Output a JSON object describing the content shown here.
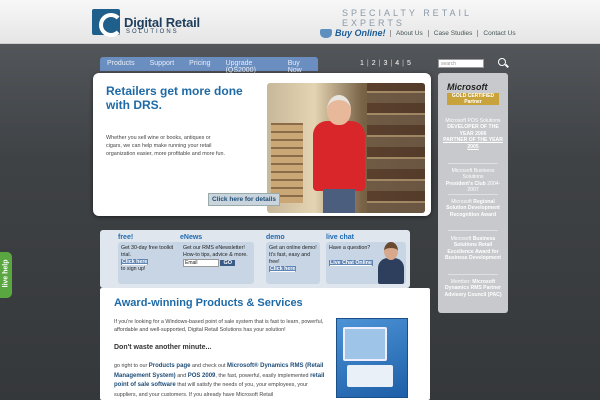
{
  "header": {
    "logo_name": "Digital Retail",
    "logo_sub": "SOLUTIONS",
    "tagline": "SPECIALTY RETAIL EXPERTS",
    "buy_online": "Buy Online!",
    "links": [
      "About Us",
      "Case Studies",
      "Contact Us"
    ]
  },
  "nav": {
    "tabs": [
      "Products",
      "Support",
      "Pricing",
      "Upgrade (QS2000)",
      "Buy Now"
    ]
  },
  "pager": [
    "1",
    "2",
    "3",
    "4",
    "5"
  ],
  "search": {
    "placeholder": "search"
  },
  "hero": {
    "title": "Retailers get more done with DRS.",
    "body": "Whether you sell wine or books, antiques or cigars, we can help make running your retail organization easier, more profitable and more fun.",
    "button": "Click here for details"
  },
  "promos": [
    {
      "title": "free!",
      "text": "Get 30-day free toolkit trial.",
      "link": "Click here",
      "after": "to sign up!"
    },
    {
      "title": "eNews",
      "text": "Get our RMS eNewsletter! How-to tips, advice & more.",
      "input_placeholder": "Email",
      "button": "GO"
    },
    {
      "title": "demo",
      "text": "Get an online demo! It's fast, easy and free!",
      "link": "Click here"
    },
    {
      "title": "live chat",
      "text": "Have a question?",
      "link": "Live Chat Online"
    }
  ],
  "live_help": "live help",
  "content": {
    "title": "Award-winning Products & Services",
    "p1": "If you're looking for a Windows-based point of sale system that is fast to learn, powerful, affordable and well-supported, Digital Retail Solutions has your solution!",
    "heading": "Don't waste another minute...",
    "p2_a": "go right to our",
    "p2_link1": "Products page",
    "p2_b": "and check out",
    "p2_bold1": "Microsoft® Dynamics RMS (Retail Management System)",
    "p2_c": "and",
    "p2_bold2": "POS 2009",
    "p2_d": ", the fast, powerful, easily implemented",
    "p2_link2": "retail point of sale software",
    "p2_e": "that will satisfy the needs of you, your employees, your suppliers, and your customers. If you already have Microsoft Retail"
  },
  "sidebar": {
    "ms_logo": "Microsoft",
    "gold_badge": "GOLD CERTIFIED Partner",
    "awards": [
      {
        "a": "Microsoft POS Solutions",
        "b": "DEVELOPER OF THE YEAR 2006",
        "c": "PARTNER OF THE YEAR 2005"
      },
      {
        "a": "Microsoft Business Solutions",
        "b": "President's Club",
        "c": "2004-2007"
      },
      {
        "a": "Microsoft",
        "b": "Regional Solution Development Recognition Award",
        "c": ""
      },
      {
        "a": "Microsoft",
        "b": "Business Solutions Retail Excellence Award for Business Development",
        "c": ""
      },
      {
        "a": "Member:",
        "b": "Microsoft Dynamics RMS Partner Advisory Council (PAC)",
        "c": ""
      }
    ]
  }
}
